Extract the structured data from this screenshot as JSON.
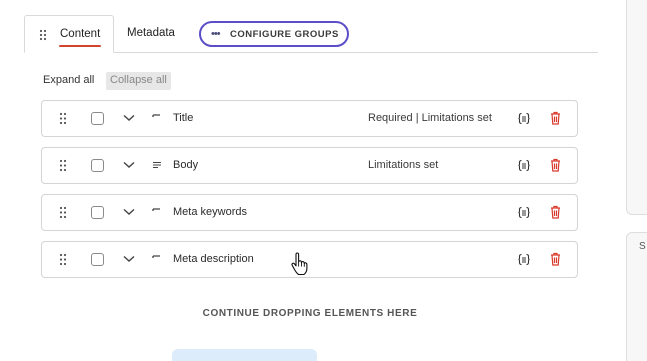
{
  "tabs": {
    "content_label": "Content",
    "metadata_label": "Metadata",
    "configure_groups_label": "CONFIGURE GROUPS"
  },
  "toolbar": {
    "expand_all": "Expand all",
    "collapse_all": "Collapse all"
  },
  "fields": [
    {
      "name": "Title",
      "info": "Required | Limitations set",
      "type_icon": "short-text-icon"
    },
    {
      "name": "Body",
      "info": "Limitations set",
      "type_icon": "long-text-icon"
    },
    {
      "name": "Meta keywords",
      "info": "",
      "type_icon": "short-text-icon"
    },
    {
      "name": "Meta description",
      "info": "",
      "type_icon": "short-text-icon"
    }
  ],
  "drop_zone": {
    "label": "CONTINUE DROPPING ELEMENTS HERE"
  },
  "side_panel": {
    "label": "S"
  },
  "colors": {
    "accent_underline": "#d2452a",
    "configure_border": "#5b4ec9",
    "delete_icon": "#d93a2b",
    "drop_placeholder": "#dcecfa"
  }
}
